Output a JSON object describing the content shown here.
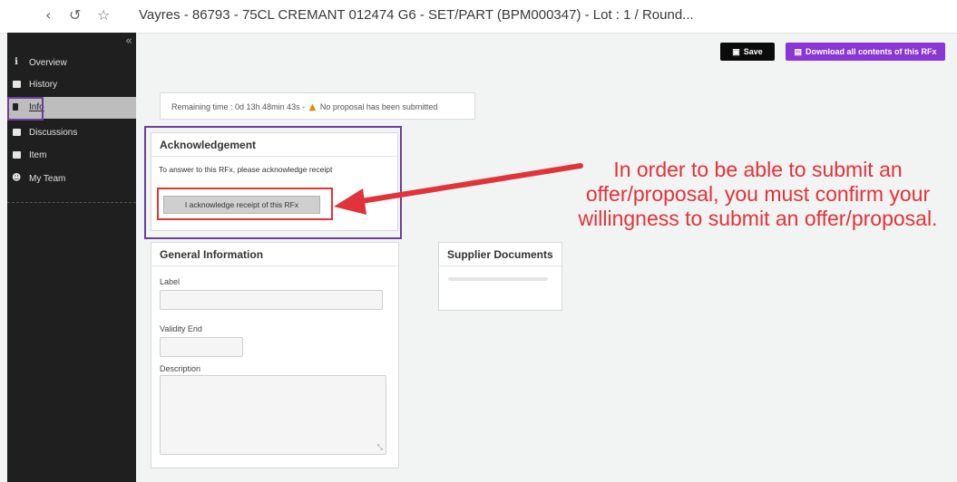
{
  "browser": {
    "back_icon": "back-icon",
    "history_icon": "history-icon",
    "star_icon": "star-icon",
    "title": "Vayres - 86793 - 75CL CREMANT 012474 G6 - SET/PART (BPM000347) - Lot : 1 / Round..."
  },
  "sidebar": {
    "collapse_icon": "double-chevron-left-icon",
    "items": [
      {
        "label": "Overview",
        "icon": "info-icon"
      },
      {
        "label": "History",
        "icon": "history-icon"
      },
      {
        "label": "Info",
        "icon": "info-doc-icon"
      },
      {
        "label": "Discussions",
        "icon": "discussions-icon"
      },
      {
        "label": "Item",
        "icon": "item-icon"
      },
      {
        "label": "My Team",
        "icon": "team-icon"
      }
    ]
  },
  "toolbar": {
    "save_label": "Save",
    "download_label": "Download all contents of this RFx"
  },
  "status": {
    "remaining_label": "Remaining time :",
    "remaining_value": "0d 13h 48min 43s -",
    "proposal_status": "No proposal has been submitted"
  },
  "acknowledgement": {
    "title": "Acknowledgement",
    "instruction": "To answer to this RFx, please acknowledge receipt",
    "button_label": "I acknowledge receipt of this RFx"
  },
  "general_info": {
    "title": "General Information",
    "label_field": "Label",
    "validity_field": "Validity End",
    "description_field": "Description"
  },
  "supplier_docs": {
    "title": "Supplier Documents"
  },
  "annotation": {
    "text": "In order to be able to submit an offer/proposal, you must confirm your willingness to submit an offer/proposal.",
    "color": "#e0343a"
  },
  "colors": {
    "accent_purple": "#8a36d6",
    "highlight_purple": "#6a3fa0",
    "sidebar_bg": "#1f1f1f"
  }
}
